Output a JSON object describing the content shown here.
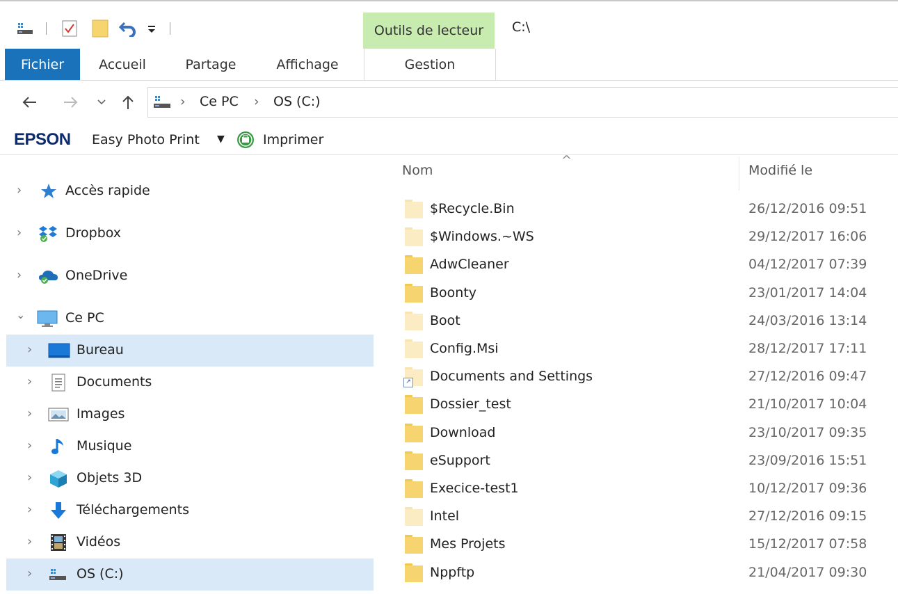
{
  "window": {
    "title": "C:\\",
    "tools_tab": "Outils de lecteur"
  },
  "ribbon": {
    "tabs": [
      {
        "label": "Fichier"
      },
      {
        "label": "Accueil"
      },
      {
        "label": "Partage"
      },
      {
        "label": "Affichage"
      },
      {
        "label": "Gestion"
      }
    ]
  },
  "address": {
    "crumbs": [
      "Ce PC",
      "OS (C:)"
    ]
  },
  "epson": {
    "brand": "EPSON",
    "app": "Easy Photo Print",
    "print": "Imprimer"
  },
  "nav": {
    "items": [
      {
        "label": "Accès rapide",
        "icon": "star-icon"
      },
      {
        "label": "Dropbox",
        "icon": "dropbox-icon"
      },
      {
        "label": "OneDrive",
        "icon": "onedrive-icon"
      },
      {
        "label": "Ce PC",
        "icon": "computer-icon"
      },
      {
        "label": "Bureau",
        "icon": "desktop-icon"
      },
      {
        "label": "Documents",
        "icon": "documents-icon"
      },
      {
        "label": "Images",
        "icon": "images-icon"
      },
      {
        "label": "Musique",
        "icon": "music-icon"
      },
      {
        "label": "Objets 3D",
        "icon": "cube-icon"
      },
      {
        "label": "Téléchargements",
        "icon": "download-icon"
      },
      {
        "label": "Vidéos",
        "icon": "video-icon"
      },
      {
        "label": "OS (C:)",
        "icon": "drive-icon"
      }
    ]
  },
  "files": {
    "columns": {
      "name": "Nom",
      "modified": "Modifié le"
    },
    "rows": [
      {
        "name": "$Recycle.Bin",
        "modified": "26/12/2016 09:51"
      },
      {
        "name": "$Windows.~WS",
        "modified": "29/12/2017 16:06"
      },
      {
        "name": "AdwCleaner",
        "modified": "04/12/2017 07:39"
      },
      {
        "name": "Boonty",
        "modified": "23/01/2017 14:04"
      },
      {
        "name": "Boot",
        "modified": "24/03/2016 13:14"
      },
      {
        "name": "Config.Msi",
        "modified": "28/12/2017 17:11"
      },
      {
        "name": "Documents and Settings",
        "modified": "27/12/2016 09:47"
      },
      {
        "name": "Dossier_test",
        "modified": "21/10/2017 10:04"
      },
      {
        "name": "Download",
        "modified": "23/10/2017 09:35"
      },
      {
        "name": "eSupport",
        "modified": "23/09/2016 15:51"
      },
      {
        "name": "Execice-test1",
        "modified": "10/12/2017 09:36"
      },
      {
        "name": "Intel",
        "modified": "27/12/2016 09:15"
      },
      {
        "name": "Mes Projets",
        "modified": "15/12/2017 07:58"
      },
      {
        "name": "Nppftp",
        "modified": "21/04/2017 09:30"
      }
    ]
  },
  "colors": {
    "accent": "#1a73ba",
    "tools_tab": "#c8ecb0",
    "selection": "#d9e9f7",
    "folder": "#f6d571"
  }
}
